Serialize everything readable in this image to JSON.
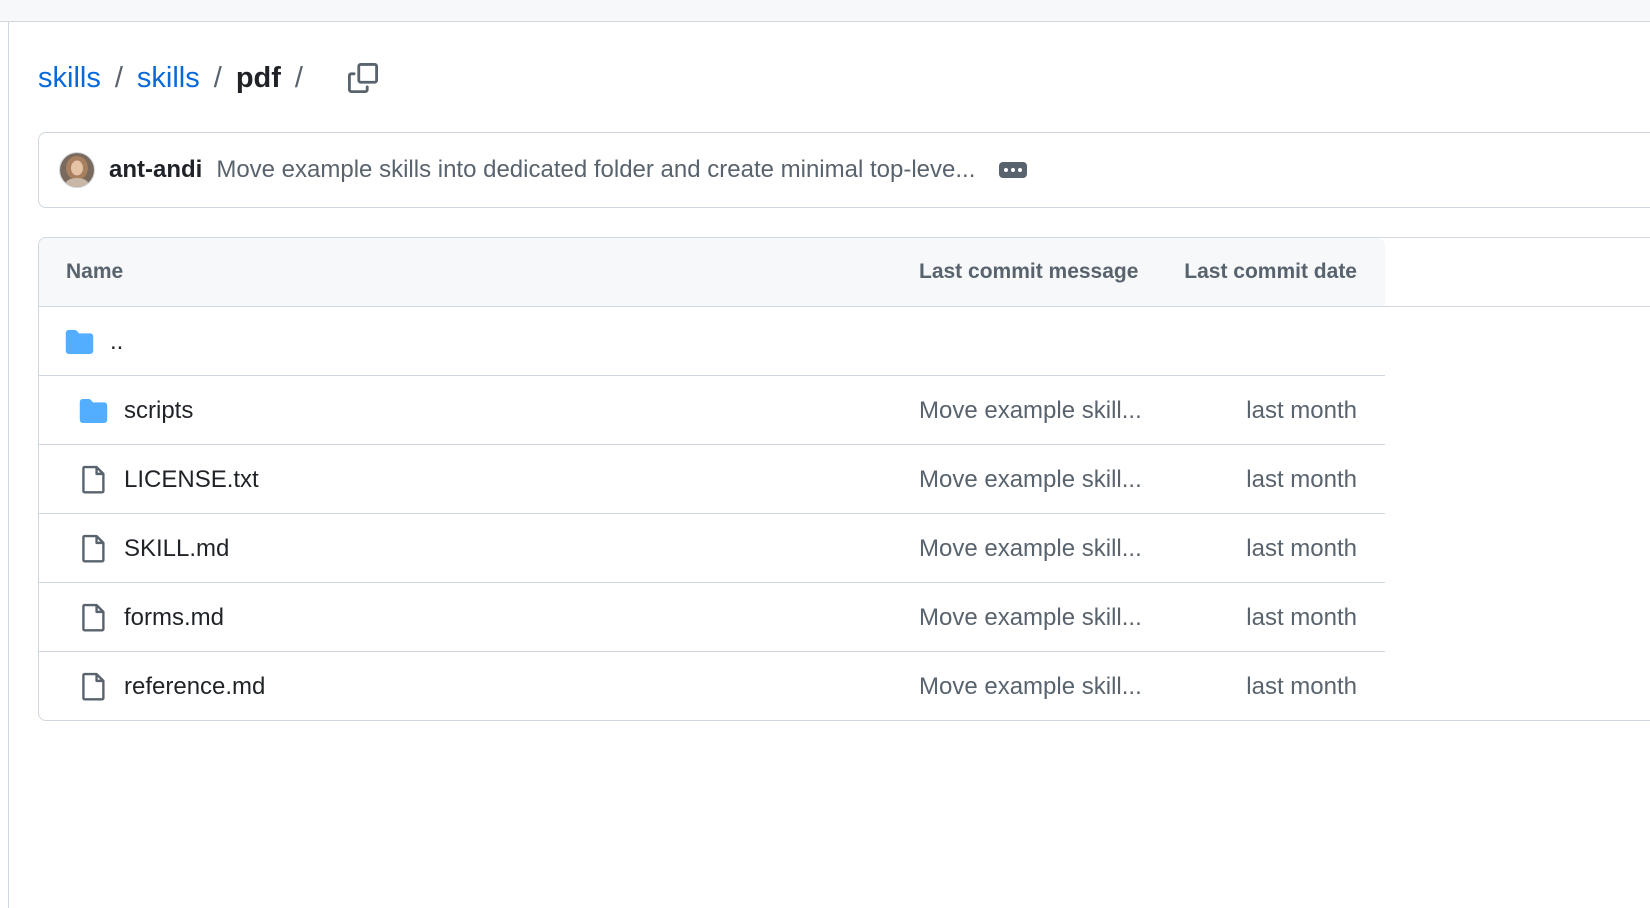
{
  "breadcrumb": {
    "items": [
      "skills",
      "skills"
    ],
    "current": "pdf",
    "separator": "/"
  },
  "commit": {
    "author": "ant-andi",
    "message": "Move example skills into dedicated folder and create minimal top-leve..."
  },
  "table": {
    "headers": {
      "name": "Name",
      "message": "Last commit message",
      "date": "Last commit date"
    },
    "parent": "..",
    "rows": [
      {
        "icon": "folder-icon",
        "name": "scripts",
        "message": "Move example skill...",
        "date": "last month"
      },
      {
        "icon": "file-icon",
        "name": "LICENSE.txt",
        "message": "Move example skill...",
        "date": "last month"
      },
      {
        "icon": "file-icon",
        "name": "SKILL.md",
        "message": "Move example skill...",
        "date": "last month"
      },
      {
        "icon": "file-icon",
        "name": "forms.md",
        "message": "Move example skill...",
        "date": "last month"
      },
      {
        "icon": "file-icon",
        "name": "reference.md",
        "message": "Move example skill...",
        "date": "last month"
      }
    ]
  },
  "colors": {
    "link": "#0969da",
    "folder": "#54aeff",
    "border": "#d0d7de",
    "muted": "#59636e"
  }
}
